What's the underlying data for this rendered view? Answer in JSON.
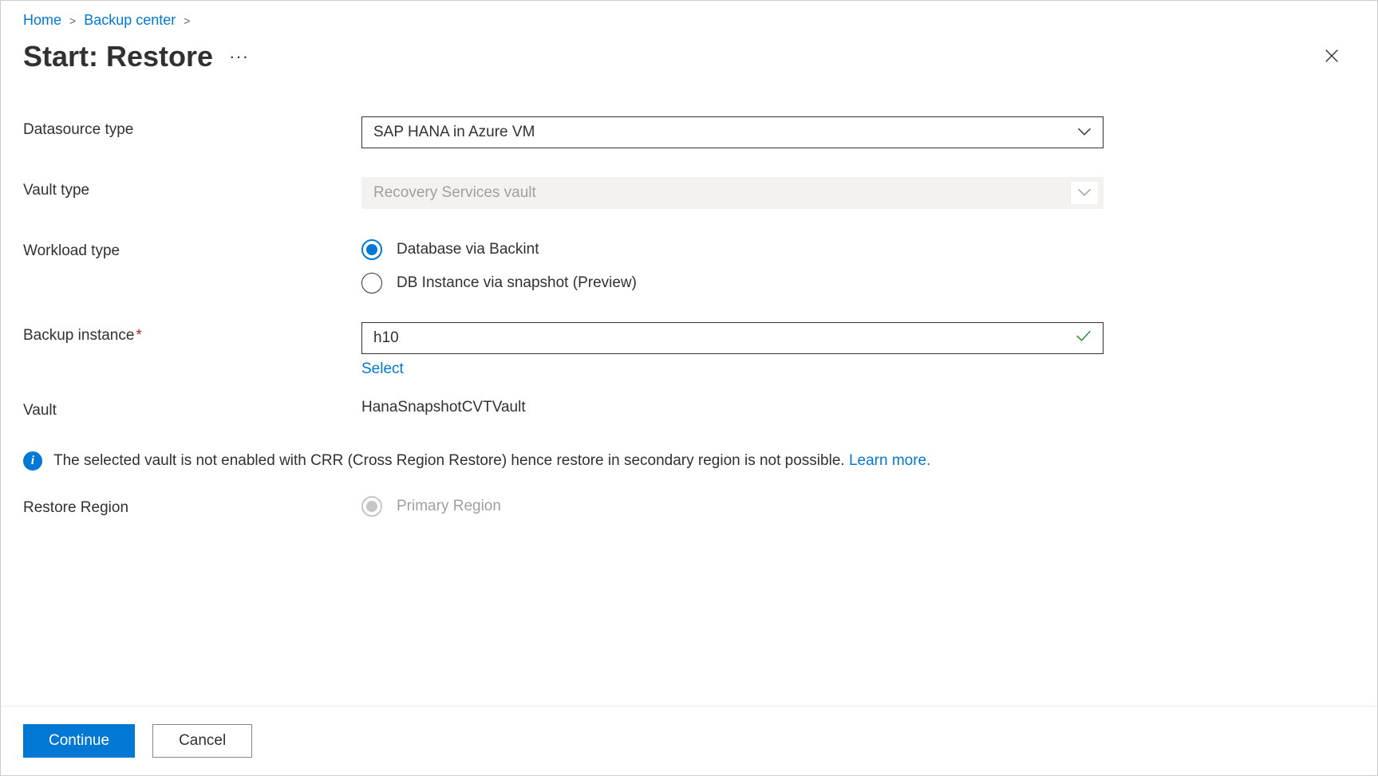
{
  "breadcrumb": {
    "home": "Home",
    "backup_center": "Backup center"
  },
  "header": {
    "title": "Start: Restore"
  },
  "form": {
    "datasource_label": "Datasource type",
    "datasource_value": "SAP HANA in Azure VM",
    "vault_type_label": "Vault type",
    "vault_type_value": "Recovery Services vault",
    "workload_label": "Workload type",
    "workload_options": {
      "backint": "Database via Backint",
      "snapshot": "DB Instance via snapshot (Preview)"
    },
    "backup_instance_label": "Backup instance",
    "backup_instance_value": "h10",
    "select_link": "Select",
    "vault_label": "Vault",
    "vault_value": "HanaSnapshotCVTVault",
    "restore_region_label": "Restore Region",
    "restore_region_option": "Primary Region"
  },
  "info": {
    "text": "The selected vault is not enabled with CRR (Cross Region Restore) hence restore in secondary region is not possible. ",
    "learn_more": "Learn more."
  },
  "footer": {
    "continue": "Continue",
    "cancel": "Cancel"
  }
}
